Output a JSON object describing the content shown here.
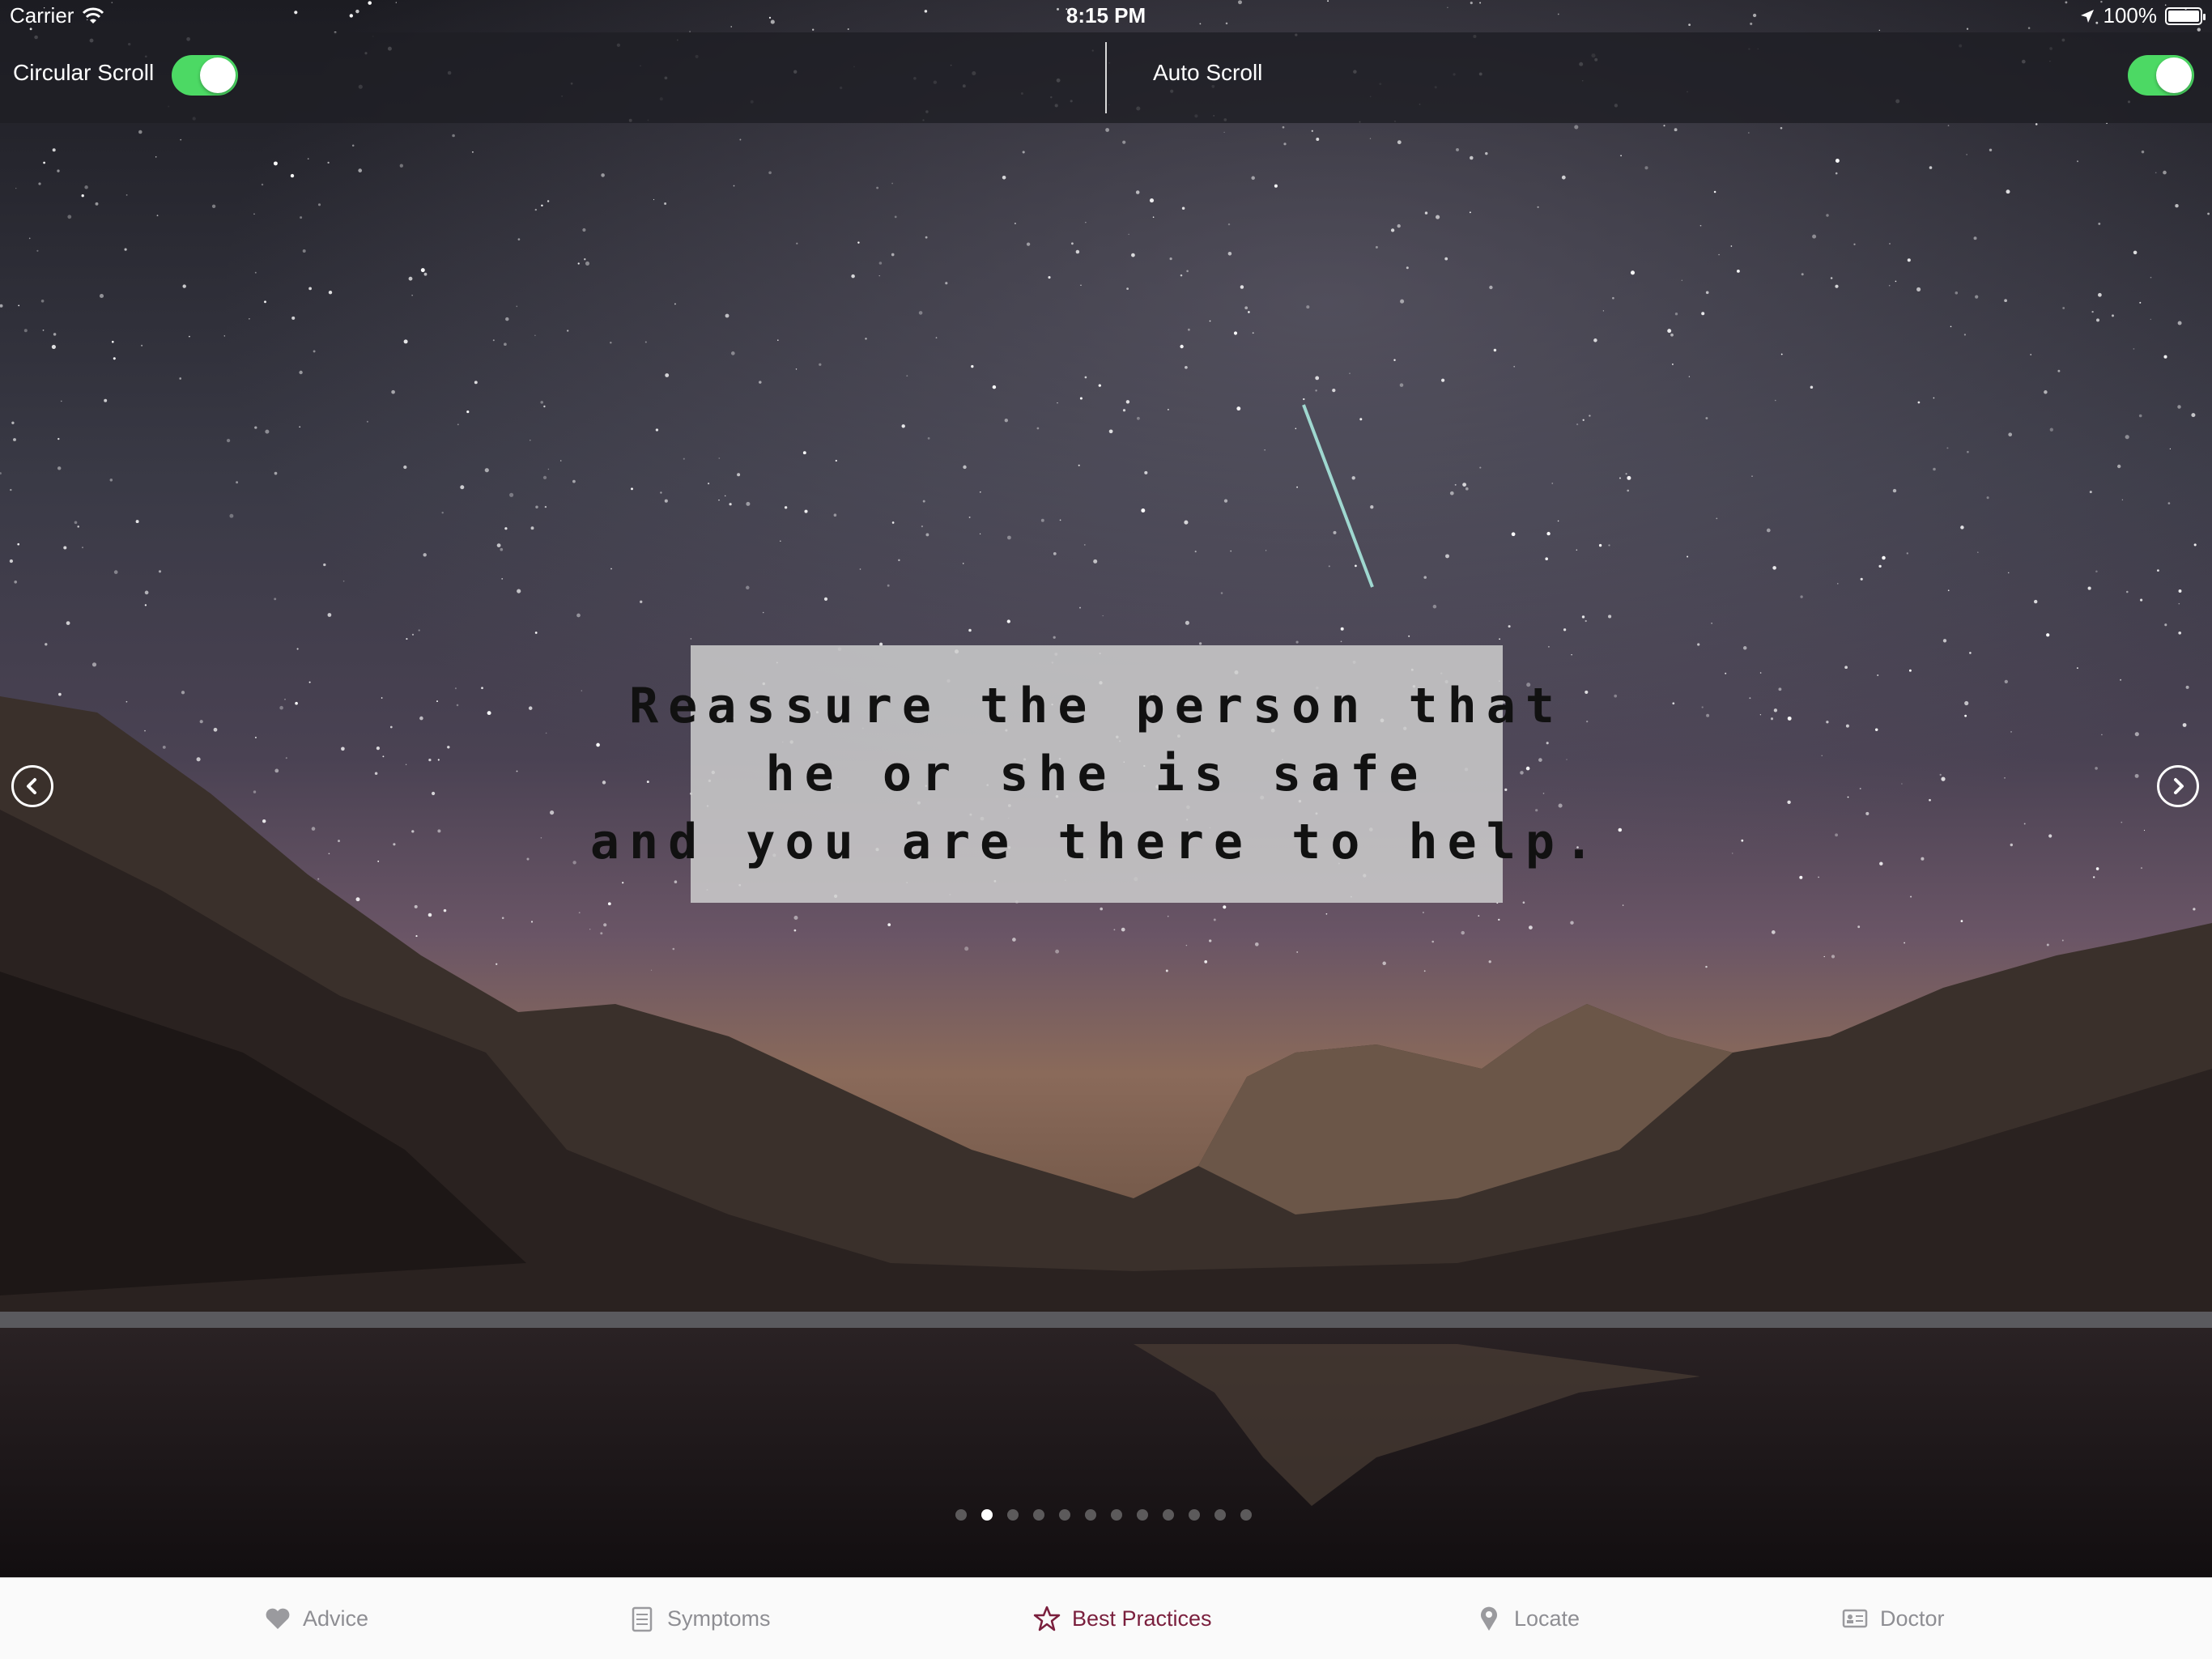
{
  "status_bar": {
    "carrier": "Carrier",
    "time": "8:15 PM",
    "battery": "100%"
  },
  "controls": {
    "circular_scroll_label": "Circular Scroll",
    "circular_scroll_on": true,
    "auto_scroll_label": "Auto Scroll",
    "auto_scroll_on": true
  },
  "slide": {
    "quote_lines": [
      "Reassure the person that",
      "he or she is safe",
      "and you are there to help."
    ],
    "current_page": 2,
    "page_count": 12
  },
  "tabs": [
    {
      "label": "Advice",
      "icon": "heart-icon",
      "active": false
    },
    {
      "label": "Symptoms",
      "icon": "clipboard-icon",
      "active": false
    },
    {
      "label": "Best Practices",
      "icon": "star-icon",
      "active": true
    },
    {
      "label": "Locate",
      "icon": "location-pin-icon",
      "active": false
    },
    {
      "label": "Doctor",
      "icon": "id-card-icon",
      "active": false
    }
  ],
  "colors": {
    "toggle_on": "#4cd964",
    "active_tab": "#7a1f3d",
    "inactive_tab": "#8e8e93"
  }
}
